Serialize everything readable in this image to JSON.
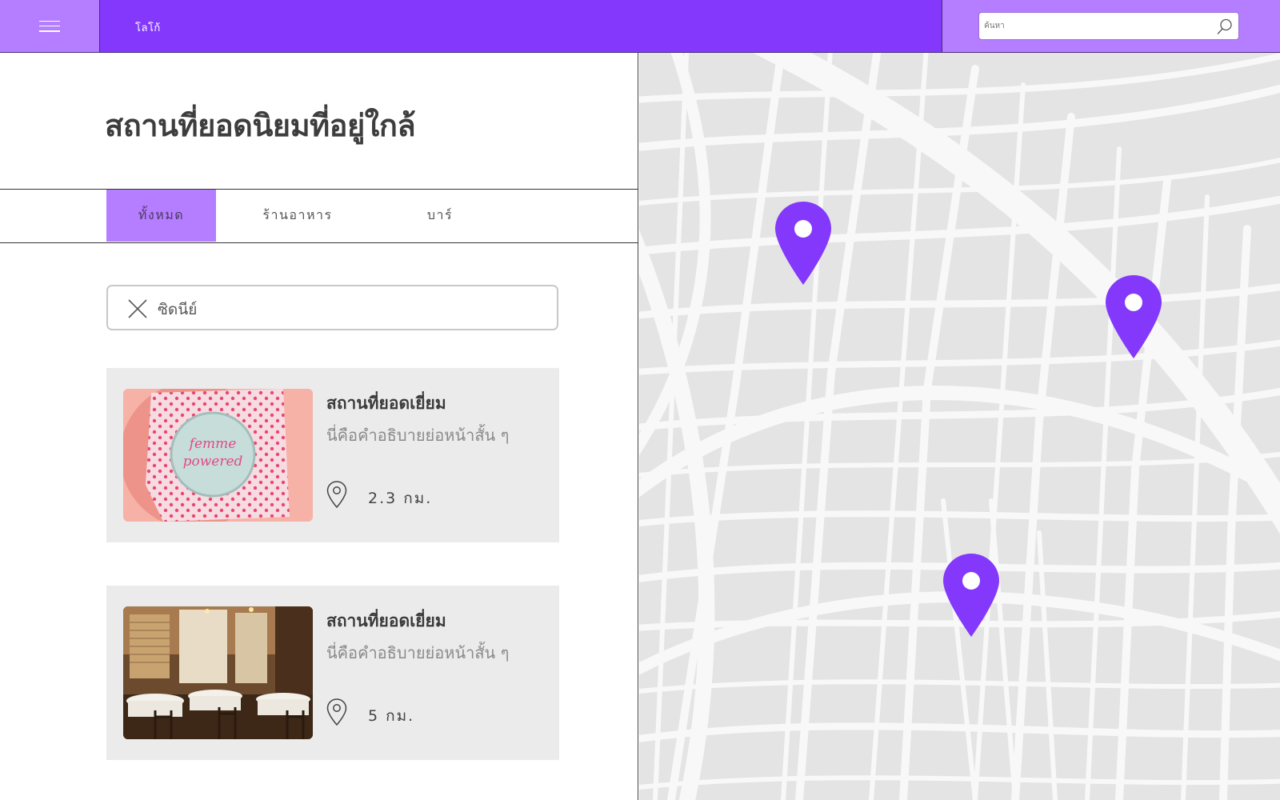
{
  "header": {
    "menu_icon": "hamburger-icon",
    "logo": "โลโก้",
    "search_placeholder": "ค้นหา",
    "search_icon": "search-icon"
  },
  "main": {
    "title": "สถานที่ยอดนิยมที่อยู่ใกล้",
    "tabs": [
      {
        "label": "ทั้งหมด",
        "active": true
      },
      {
        "label": "ร้านอาหาร",
        "active": false
      },
      {
        "label": "บาร์",
        "active": false
      }
    ],
    "filter": {
      "value": "ซิดนีย์",
      "close_icon": "close-icon"
    },
    "places": [
      {
        "name": "สถานที่ยอดเยี่ยม",
        "description": "นี่คือคำอธิบายย่อหน้าสั้น ๆ",
        "distance": "2.3 กม.",
        "image": "cake-photo"
      },
      {
        "name": "สถานที่ยอดเยี่ยม",
        "description": "นี่คือคำอธิบายย่อหน้าสั้น ๆ",
        "distance": "5 กม.",
        "image": "restaurant-interior-photo"
      }
    ]
  },
  "map": {
    "marker_count": 3,
    "marker_icon": "map-pin-icon"
  },
  "colors": {
    "accent": "#8338fc",
    "accent_light": "#b57dff",
    "card_bg": "#ebebeb",
    "map_block": "#e4e4e4",
    "map_road": "#f8f8f8"
  }
}
